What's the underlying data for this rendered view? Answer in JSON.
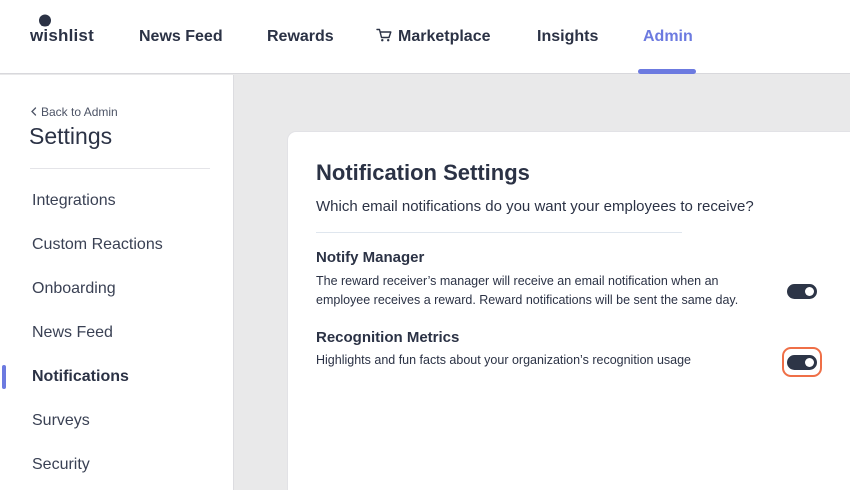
{
  "brand": {
    "name": "wishlist"
  },
  "topnav": {
    "items": [
      {
        "label": "News Feed"
      },
      {
        "label": "Rewards"
      },
      {
        "label": "Marketplace"
      },
      {
        "label": "Insights"
      },
      {
        "label": "Admin"
      }
    ],
    "active": "Admin",
    "accent_color": "#6c7ae0"
  },
  "sidebar": {
    "back_label": "Back to Admin",
    "title": "Settings",
    "items": [
      {
        "label": "Integrations"
      },
      {
        "label": "Custom Reactions"
      },
      {
        "label": "Onboarding"
      },
      {
        "label": "News Feed"
      },
      {
        "label": "Notifications"
      },
      {
        "label": "Surveys"
      },
      {
        "label": "Security"
      }
    ],
    "active": "Notifications"
  },
  "main": {
    "title": "Notification Settings",
    "subtitle": "Which email notifications do you want your employees to receive?",
    "settings": [
      {
        "title": "Notify Manager",
        "description": "The reward receiver’s manager will receive an email notification when an employee receives a reward. Reward notifications will be sent the same day.",
        "enabled": true
      },
      {
        "title": "Recognition Metrics",
        "description": "Highlights and fun facts about your organization’s recognition usage",
        "enabled": true,
        "focused": true
      }
    ]
  },
  "colors": {
    "toggle_on": "#2d3547",
    "focus_ring": "#ef6f47"
  }
}
